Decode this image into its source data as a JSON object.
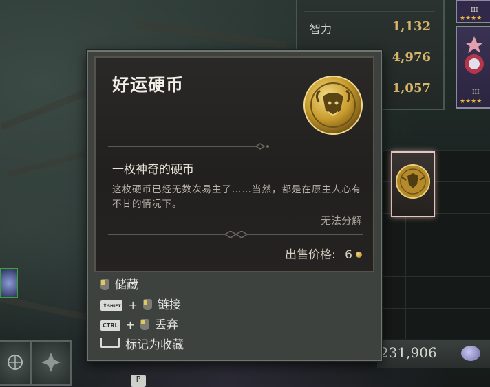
{
  "stats": [
    {
      "name": "",
      "value": ""
    },
    {
      "name": "智力",
      "value": "1,132"
    },
    {
      "name": "",
      "value": "4,976"
    },
    {
      "name": "",
      "value": "1,057"
    }
  ],
  "tooltip": {
    "title": "好运硬币",
    "subtitle": "一枚神奇的硬币",
    "description": "这枚硬币已经无数次易主了……当然，都是在原主人心有不甘的情况下。",
    "flag": "无法分解",
    "sell_label": "出售价格:",
    "sell_value": "6",
    "icon": "lucky-coin-icon",
    "actions": [
      {
        "modifier": "",
        "label": "储藏"
      },
      {
        "modifier": "SHIFT",
        "label": "链接"
      },
      {
        "modifier": "CTRL",
        "label": "丢弃"
      },
      {
        "modifier": "SPACE",
        "label": "标记为收藏"
      }
    ]
  },
  "currency": {
    "value": "231,906",
    "icon": "soul-gem-icon"
  },
  "hotkey": "P",
  "colors": {
    "gold": "#d9b56a",
    "coin": "#c9a23a",
    "highlight": "#e4c7c0"
  }
}
